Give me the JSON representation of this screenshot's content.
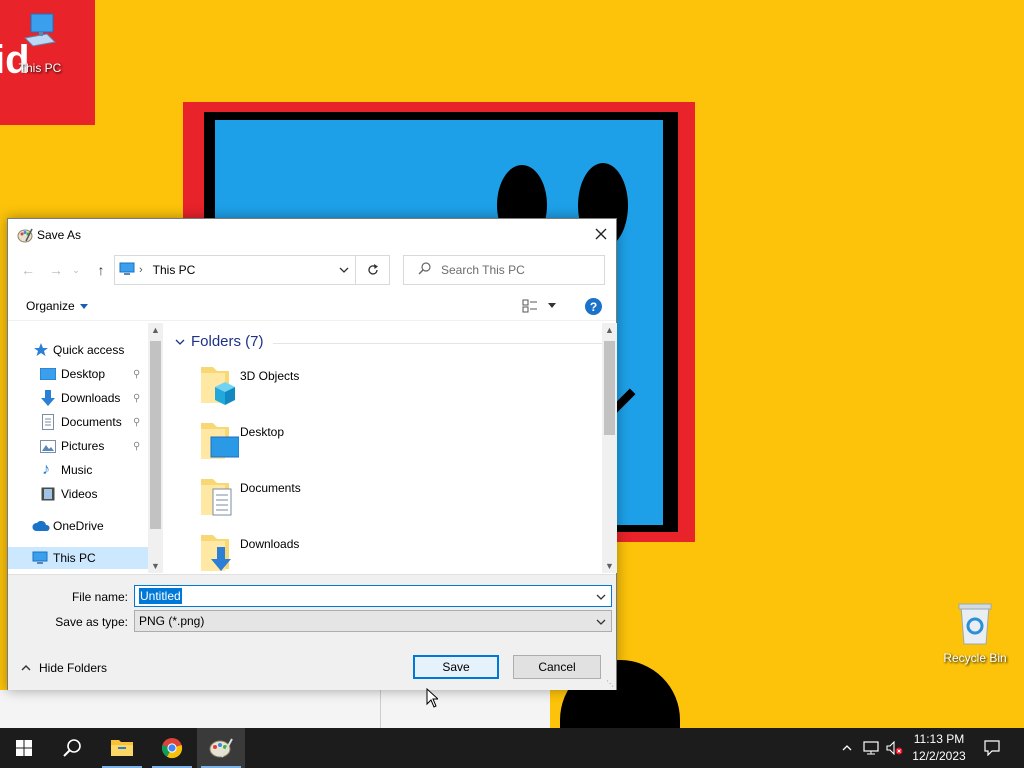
{
  "desktop": {
    "icons": [
      {
        "label": "This PC"
      },
      {
        "label": "Recycle Bin"
      }
    ]
  },
  "dialog": {
    "title": "Save As",
    "address": {
      "crumb": "This PC"
    },
    "search": {
      "placeholder": "Search This PC"
    },
    "toolbar": {
      "organize": "Organize"
    },
    "nav": {
      "quick_access": "Quick access",
      "items": [
        "Desktop",
        "Downloads",
        "Documents",
        "Pictures",
        "Music",
        "Videos"
      ],
      "onedrive": "OneDrive",
      "this_pc": "This PC"
    },
    "content": {
      "group_label": "Folders (7)",
      "folders": [
        "3D Objects",
        "Desktop",
        "Documents",
        "Downloads"
      ]
    },
    "form": {
      "file_name_label": "File name:",
      "file_name_value": "Untitled",
      "type_label": "Save as type:",
      "type_value": "PNG (*.png)",
      "hide_folders": "Hide Folders",
      "save": "Save",
      "cancel": "Cancel"
    }
  },
  "taskbar": {
    "time": "11:13 PM",
    "date": "12/2/2023"
  },
  "colors": {
    "accent": "#0078d7",
    "wallpaper_yellow": "#fcc30a",
    "wallpaper_red": "#e8232a",
    "wallpaper_blue": "#1ea0e8"
  }
}
